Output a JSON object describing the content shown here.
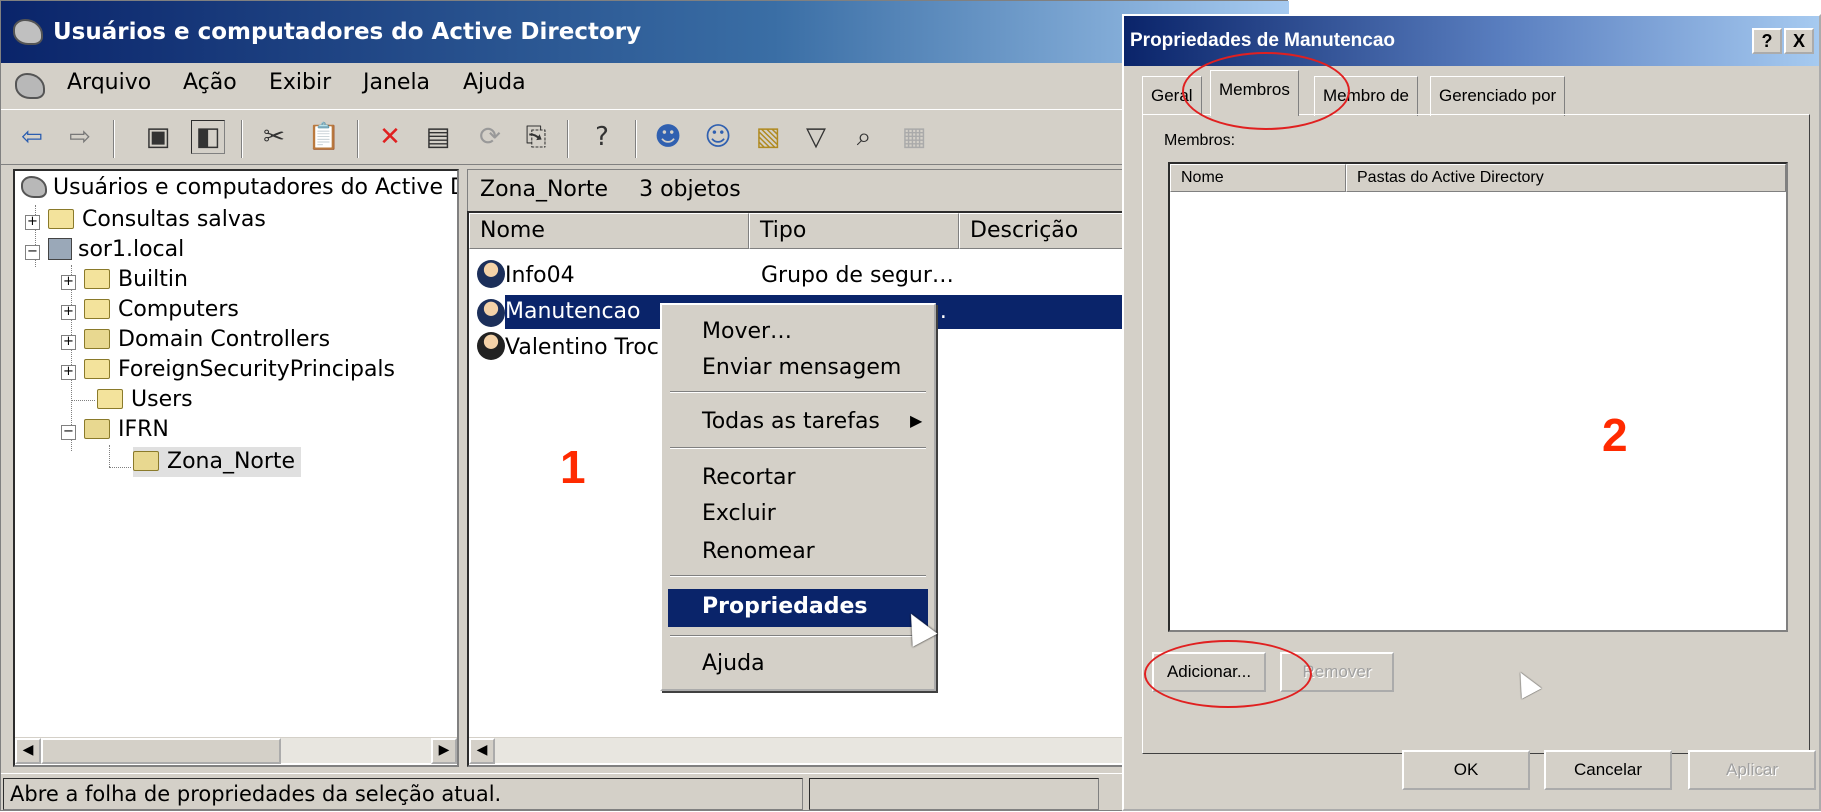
{
  "window": {
    "title": "Usuários e computadores do Active Directory",
    "menu": [
      "Arquivo",
      "Ação",
      "Exibir",
      "Janela",
      "Ajuda"
    ]
  },
  "tree": {
    "root": "Usuários e computadores do Active Di",
    "items": [
      {
        "label": "Consultas salvas"
      },
      {
        "label": "sor1.local"
      },
      {
        "label": "Builtin"
      },
      {
        "label": "Computers"
      },
      {
        "label": "Domain Controllers"
      },
      {
        "label": "ForeignSecurityPrincipals"
      },
      {
        "label": "Users"
      },
      {
        "label": "IFRN"
      },
      {
        "label": "Zona_Norte"
      }
    ]
  },
  "list": {
    "container": "Zona_Norte",
    "count": "3 objetos",
    "columns": [
      "Nome",
      "Tipo",
      "Descrição"
    ],
    "rows": [
      {
        "name": "Info04",
        "type": "Grupo de segur…"
      },
      {
        "name": "Manutencao",
        "type": "…"
      },
      {
        "name": "Valentino Troc",
        "type": ""
      }
    ]
  },
  "context_menu": {
    "items": [
      "Mover…",
      "Enviar mensagem",
      "Todas as tarefas",
      "Recortar",
      "Excluir",
      "Renomear",
      "Propriedades",
      "Ajuda"
    ]
  },
  "status_bar": {
    "text": "Abre a folha de propriedades da seleção atual."
  },
  "dialog": {
    "title": "Propriedades de Manutencao",
    "help_btn": "?",
    "close_btn": "X",
    "tabs": [
      "Geral",
      "Membros",
      "Membro de",
      "Gerenciado por"
    ],
    "members_label": "Membros:",
    "columns": [
      "Nome",
      "Pastas do Active Directory"
    ],
    "add_button": "Adicionar...",
    "remove_button": "Remover",
    "ok_button": "OK",
    "cancel_button": "Cancelar",
    "apply_button": "Aplicar"
  },
  "annotations": {
    "step1": "1",
    "step2": "2",
    "color": "#ff2a00"
  }
}
